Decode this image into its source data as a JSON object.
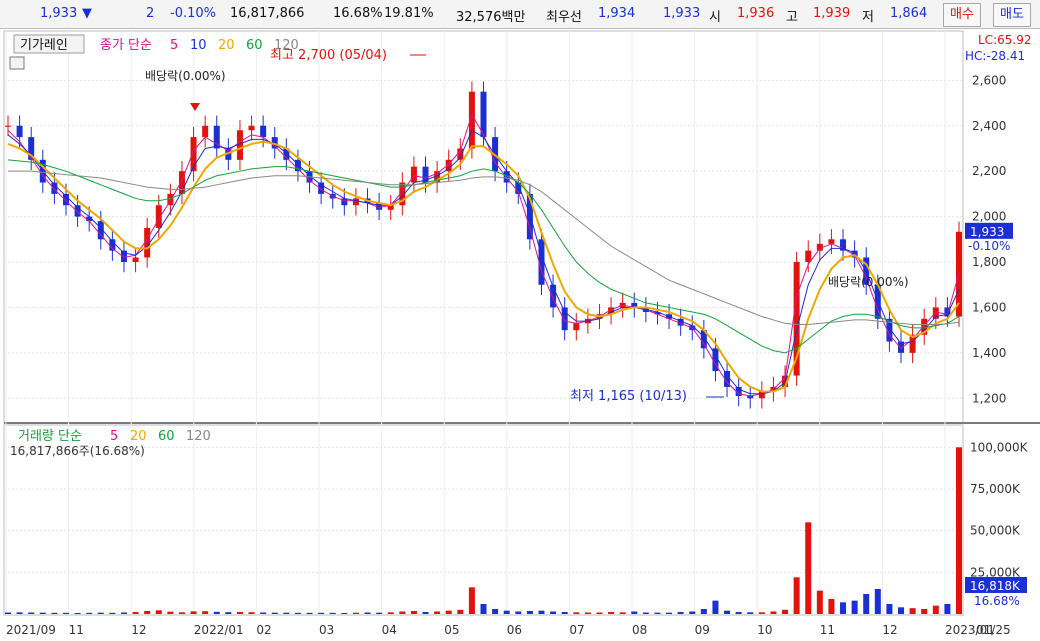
{
  "header": {
    "price": "1,933",
    "arrow": "▼",
    "change": "2",
    "change_pct": "-0.10%",
    "volume": "16,817,866",
    "vol_ratio": "16.68%",
    "turnover": "19.81%",
    "amount": "32,576백만",
    "best_ask_label": "최우선",
    "best_ask": "1,934",
    "best_bid": "1,933",
    "open_label": "시",
    "open": "1,936",
    "high_label": "고",
    "high": "1,939",
    "low_label": "저",
    "low": "1,864",
    "buy_label": "매수",
    "sell_label": "매도",
    "colors": {
      "up": "#e3120b",
      "down": "#1a2fd4"
    }
  },
  "chart_data": [
    {
      "type": "candlestick",
      "toolbar_button": "기가레인",
      "legend": {
        "prefix": "종가 단순",
        "periods": [
          "5",
          "10",
          "20",
          "60",
          "120"
        ],
        "colors": [
          "#e0118f",
          "#1a2fd4",
          "#f0a800",
          "#11a33a",
          "#888888"
        ]
      },
      "indicator_lc": "LC:65.92",
      "indicator_hc": "HC:-28.41",
      "y_ticks": [
        "2,600",
        "2,400",
        "2,200",
        "2,000",
        "1,800",
        "1,600",
        "1,400",
        "1,200"
      ],
      "ylim": [
        1100,
        2760
      ],
      "current_price": "1,933",
      "current_change": "-0.10%",
      "annotations": {
        "high": "최고 2,700 (05/04)",
        "low": "최저 1,165 (10/13)",
        "dividend": "배당락(0.00%)"
      },
      "series": [
        {
          "name": "종가",
          "values": [
            2400,
            2350,
            2250,
            2150,
            2100,
            2050,
            2000,
            1980,
            1900,
            1850,
            1800,
            1820,
            1950,
            2050,
            2100,
            2200,
            2350,
            2400,
            2300,
            2250,
            2380,
            2400,
            2350,
            2300,
            2250,
            2200,
            2150,
            2100,
            2080,
            2050,
            2080,
            2060,
            2030,
            2050,
            2150,
            2220,
            2150,
            2200,
            2250,
            2300,
            2550,
            2350,
            2200,
            2150,
            2100,
            1900,
            1700,
            1600,
            1500,
            1530,
            1550,
            1570,
            1600,
            1620,
            1600,
            1580,
            1570,
            1550,
            1520,
            1500,
            1420,
            1320,
            1250,
            1210,
            1200,
            1230,
            1250,
            1300,
            1800,
            1850,
            1880,
            1900,
            1850,
            1820,
            1700,
            1550,
            1450,
            1400,
            1480,
            1550,
            1600,
            1560,
            1933
          ]
        },
        {
          "name": "5",
          "values": [
            2380,
            2330,
            2260,
            2180,
            2120,
            2070,
            2020,
            1980,
            1920,
            1860,
            1820,
            1830,
            1900,
            1990,
            2070,
            2160,
            2290,
            2350,
            2320,
            2290,
            2330,
            2360,
            2350,
            2310,
            2260,
            2210,
            2160,
            2120,
            2090,
            2070,
            2070,
            2060,
            2040,
            2050,
            2110,
            2180,
            2170,
            2190,
            2230,
            2290,
            2450,
            2360,
            2240,
            2170,
            2110,
            1950,
            1760,
            1640,
            1540,
            1530,
            1540,
            1560,
            1590,
            1610,
            1600,
            1590,
            1570,
            1550,
            1530,
            1510,
            1440,
            1350,
            1270,
            1220,
            1210,
            1220,
            1240,
            1290,
            1650,
            1790,
            1860,
            1880,
            1860,
            1830,
            1730,
            1590,
            1480,
            1420,
            1460,
            1520,
            1580,
            1570,
            1750
          ]
        },
        {
          "name": "10",
          "values": [
            2360,
            2320,
            2270,
            2200,
            2140,
            2090,
            2040,
            2000,
            1950,
            1890,
            1840,
            1830,
            1870,
            1940,
            2020,
            2110,
            2220,
            2300,
            2310,
            2300,
            2320,
            2340,
            2340,
            2320,
            2280,
            2230,
            2180,
            2140,
            2110,
            2080,
            2070,
            2060,
            2050,
            2050,
            2090,
            2150,
            2160,
            2180,
            2210,
            2260,
            2380,
            2350,
            2270,
            2200,
            2140,
            2010,
            1830,
            1690,
            1580,
            1540,
            1540,
            1550,
            1580,
            1600,
            1600,
            1590,
            1580,
            1560,
            1540,
            1520,
            1470,
            1390,
            1300,
            1240,
            1220,
            1220,
            1230,
            1270,
            1500,
            1700,
            1810,
            1860,
            1860,
            1840,
            1760,
            1630,
            1510,
            1440,
            1450,
            1500,
            1560,
            1570,
            1680
          ]
        },
        {
          "name": "20",
          "values": [
            2320,
            2300,
            2270,
            2220,
            2170,
            2120,
            2070,
            2030,
            1990,
            1940,
            1890,
            1860,
            1860,
            1900,
            1960,
            2040,
            2130,
            2210,
            2260,
            2280,
            2300,
            2320,
            2330,
            2320,
            2300,
            2260,
            2220,
            2180,
            2140,
            2110,
            2090,
            2070,
            2060,
            2050,
            2070,
            2110,
            2130,
            2160,
            2190,
            2230,
            2310,
            2310,
            2270,
            2230,
            2180,
            2080,
            1930,
            1790,
            1670,
            1600,
            1570,
            1560,
            1570,
            1590,
            1600,
            1600,
            1590,
            1580,
            1560,
            1540,
            1500,
            1440,
            1360,
            1290,
            1250,
            1230,
            1230,
            1250,
            1380,
            1550,
            1680,
            1770,
            1820,
            1830,
            1790,
            1700,
            1590,
            1500,
            1470,
            1490,
            1530,
            1550,
            1620
          ]
        },
        {
          "name": "60",
          "values": [
            2250,
            2245,
            2240,
            2230,
            2215,
            2200,
            2180,
            2160,
            2140,
            2120,
            2100,
            2080,
            2070,
            2070,
            2080,
            2100,
            2130,
            2160,
            2180,
            2190,
            2200,
            2210,
            2215,
            2220,
            2220,
            2210,
            2200,
            2190,
            2180,
            2170,
            2160,
            2150,
            2140,
            2130,
            2130,
            2140,
            2150,
            2160,
            2170,
            2180,
            2200,
            2210,
            2200,
            2180,
            2150,
            2100,
            2030,
            1950,
            1870,
            1800,
            1750,
            1710,
            1680,
            1660,
            1640,
            1620,
            1610,
            1600,
            1590,
            1580,
            1570,
            1550,
            1520,
            1490,
            1460,
            1430,
            1410,
            1400,
            1420,
            1460,
            1500,
            1540,
            1560,
            1570,
            1570,
            1560,
            1540,
            1520,
            1510,
            1510,
            1520,
            1530,
            1560
          ]
        },
        {
          "name": "120",
          "values": [
            2200,
            2200,
            2200,
            2195,
            2190,
            2185,
            2180,
            2175,
            2170,
            2160,
            2150,
            2140,
            2130,
            2125,
            2120,
            2120,
            2125,
            2130,
            2140,
            2150,
            2160,
            2170,
            2175,
            2180,
            2180,
            2180,
            2175,
            2170,
            2165,
            2160,
            2155,
            2150,
            2145,
            2140,
            2140,
            2140,
            2145,
            2150,
            2155,
            2160,
            2170,
            2175,
            2175,
            2170,
            2160,
            2140,
            2110,
            2070,
            2030,
            1990,
            1950,
            1910,
            1870,
            1840,
            1810,
            1780,
            1750,
            1720,
            1700,
            1680,
            1660,
            1640,
            1620,
            1600,
            1580,
            1560,
            1545,
            1530,
            1525,
            1525,
            1530,
            1535,
            1540,
            1545,
            1545,
            1540,
            1535,
            1530,
            1525,
            1525,
            1525,
            1528,
            1535
          ]
        }
      ]
    },
    {
      "type": "bar",
      "legend": {
        "prefix": "거래량 단순",
        "periods": [
          "5",
          "20",
          "60",
          "120"
        ],
        "colors": [
          "#e0118f",
          "#f0a800",
          "#11a33a",
          "#888888"
        ]
      },
      "volume_text": "16,817,866주(16.68%)",
      "y_ticks": [
        "100,000K",
        "75,000K",
        "50,000K",
        "25,000K"
      ],
      "ylim": [
        0,
        108000
      ],
      "current_volume": "16,818K",
      "current_pct": "16.68%",
      "values": [
        900,
        1000,
        900,
        800,
        700,
        700,
        600,
        700,
        800,
        700,
        900,
        1200,
        1800,
        2200,
        1400,
        1000,
        1600,
        1700,
        1300,
        1100,
        1200,
        1100,
        900,
        800,
        800,
        700,
        700,
        700,
        700,
        600,
        800,
        900,
        800,
        1000,
        1500,
        1800,
        1200,
        1500,
        2000,
        2500,
        16000,
        6000,
        3000,
        2000,
        1500,
        1800,
        2000,
        1500,
        1200,
        1000,
        900,
        900,
        1200,
        1000,
        1500,
        900,
        800,
        800,
        1200,
        1500,
        3000,
        8000,
        2000,
        1200,
        1000,
        1000,
        1500,
        2500,
        22000,
        55000,
        14000,
        9000,
        7000,
        8000,
        12000,
        15000,
        6000,
        4000,
        3500,
        3000,
        5000,
        6000,
        100000
      ],
      "colors": [
        "#e3120b",
        "#1a2fd4"
      ]
    }
  ],
  "x_axis": [
    "2021/09",
    "11",
    "12",
    "2022/01",
    "02",
    "03",
    "04",
    "05",
    "06",
    "07",
    "08",
    "09",
    "10",
    "11",
    "12",
    "2023/01",
    "01/25"
  ]
}
